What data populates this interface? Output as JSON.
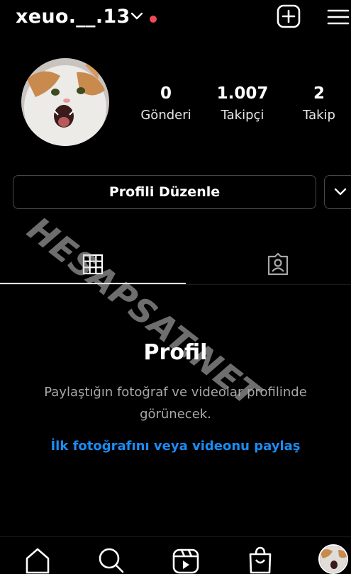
{
  "header": {
    "username": "xeuo.__.13",
    "notification_color": "#ed4956",
    "icons": [
      "chevron-down-icon",
      "new-post-icon",
      "hamburger-menu-icon"
    ]
  },
  "stats": [
    {
      "value": "0",
      "label": "Gönderi"
    },
    {
      "value": "1.007",
      "label": "Takipçi"
    },
    {
      "value": "2",
      "label": "Takip"
    }
  ],
  "actions": {
    "edit_profile": "Profili Düzenle"
  },
  "tabs": [
    "grid-icon",
    "tagged-icon"
  ],
  "watermark": "HESAPSAT.NET",
  "empty_state": {
    "title": "Profil",
    "description": "Paylaştığın fotoğraf ve videolar profilinde görünecek.",
    "link": "İlk fotoğrafını veya videonu paylaş",
    "link_color": "#1a8cf5"
  },
  "bottom_nav": [
    "home-icon",
    "search-icon",
    "reels-icon",
    "shop-icon",
    "profile-avatar"
  ]
}
